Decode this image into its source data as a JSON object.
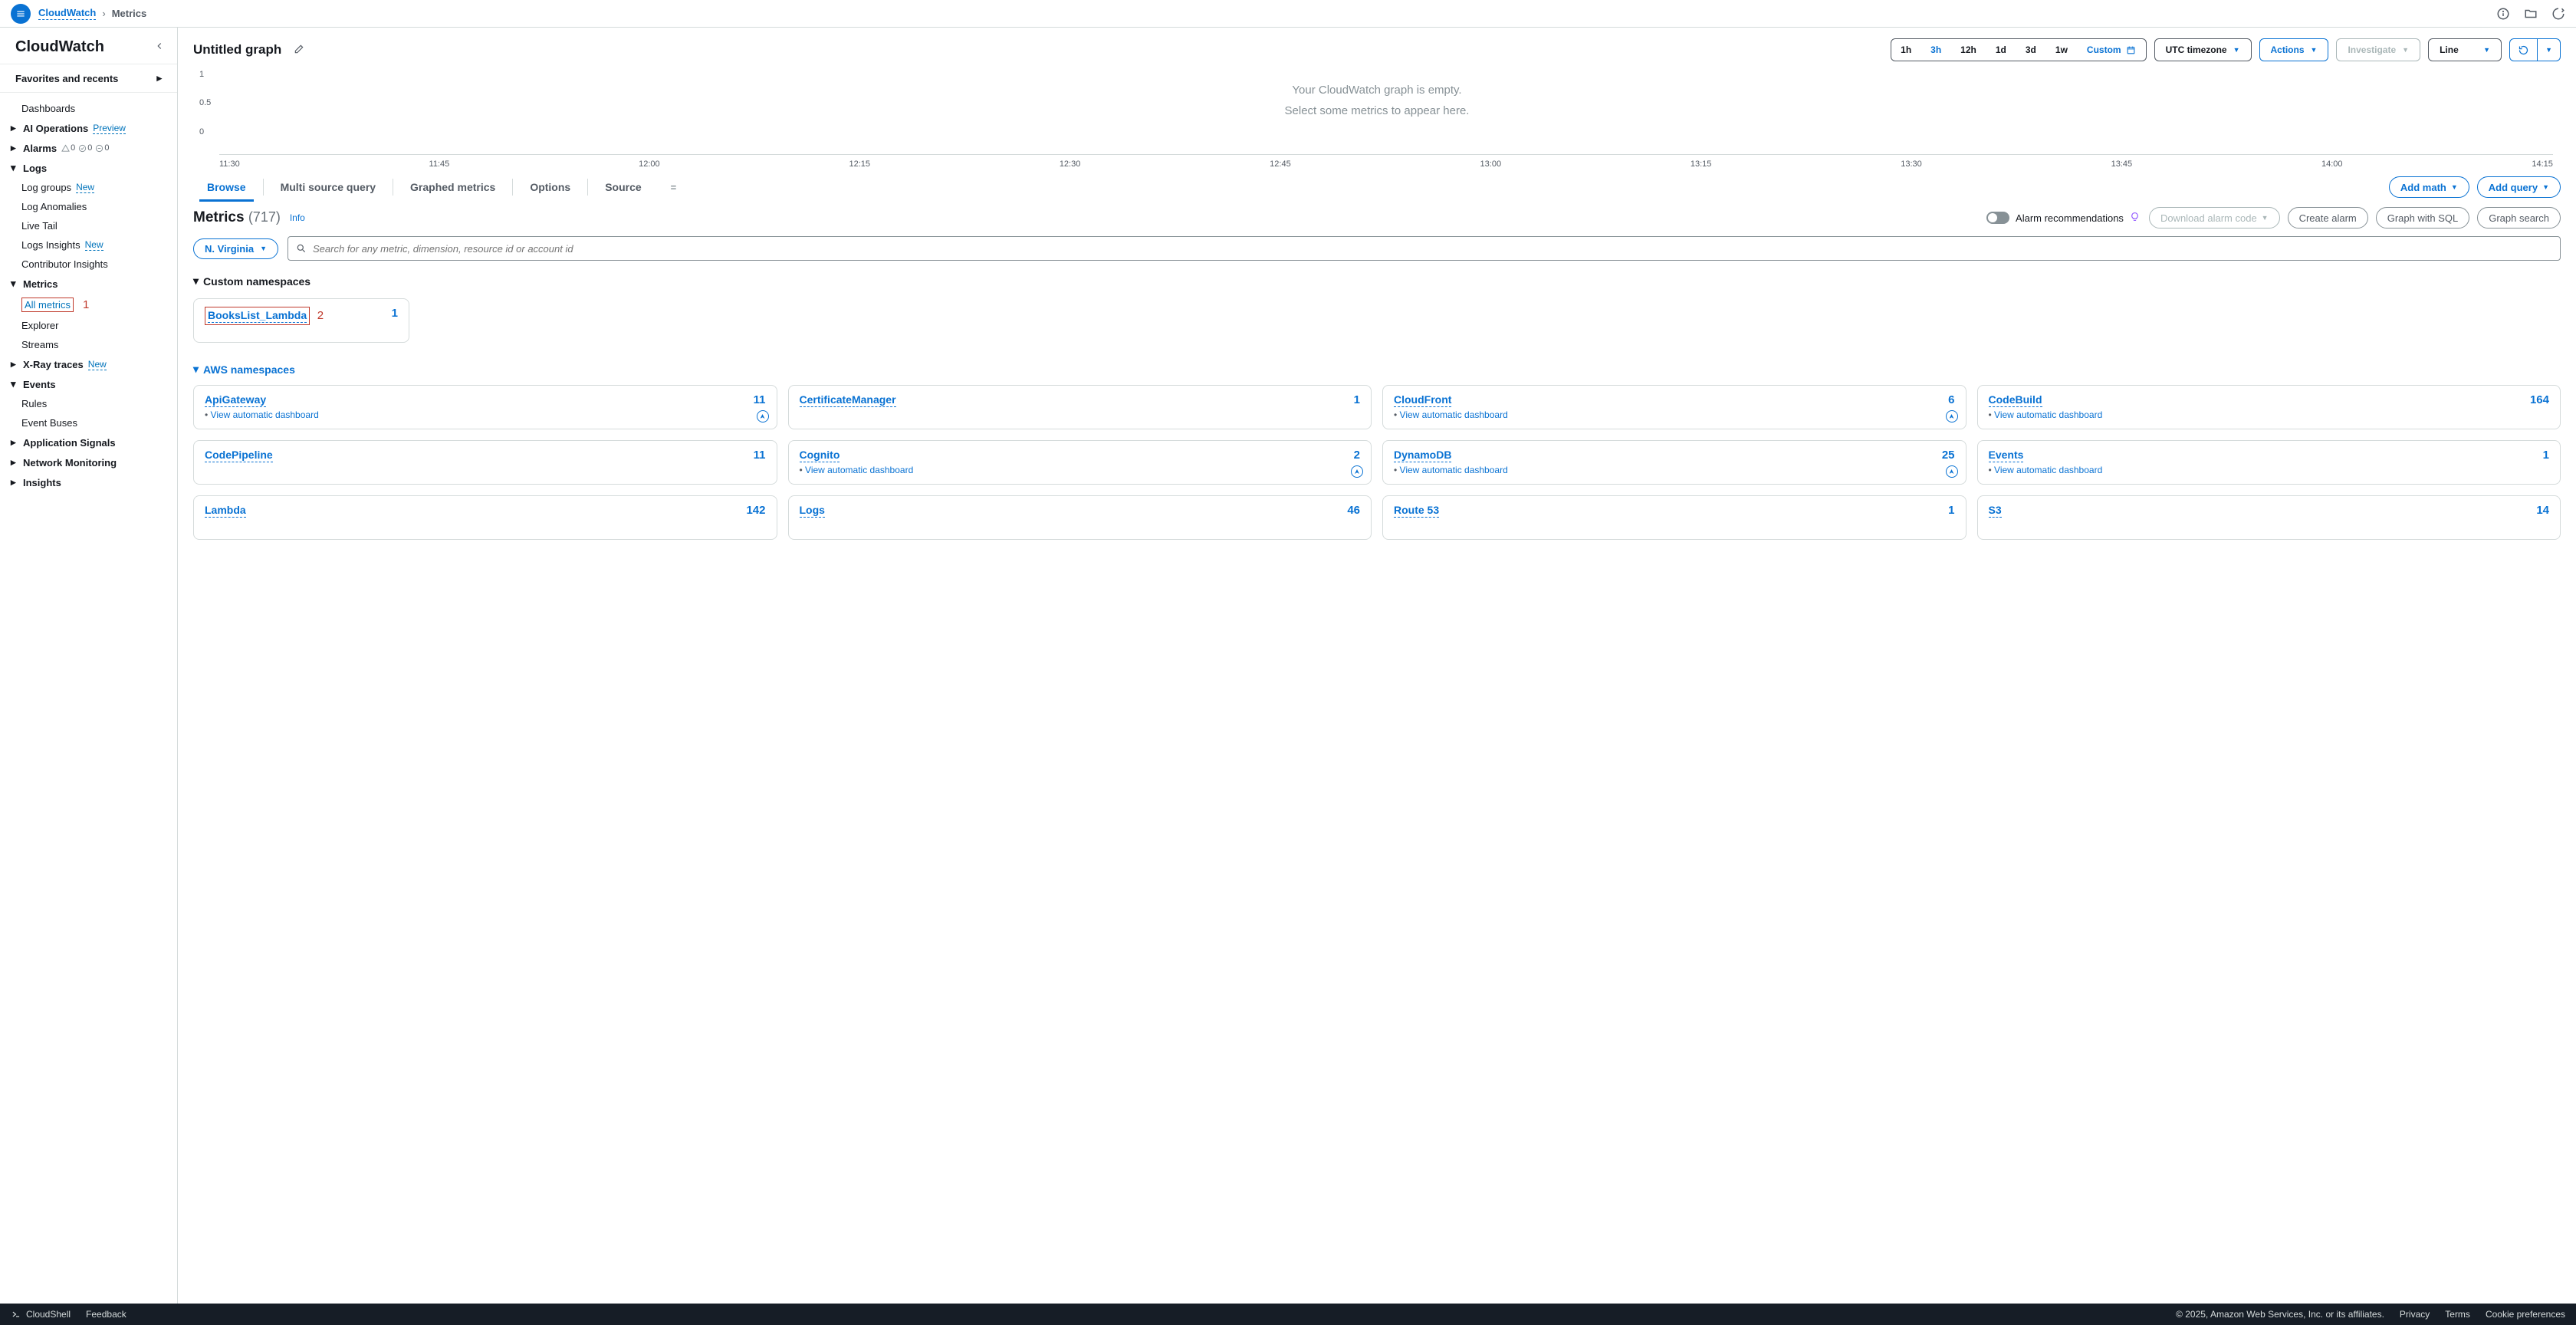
{
  "breadcrumb": {
    "service": "CloudWatch",
    "current": "Metrics"
  },
  "sidebar": {
    "title": "CloudWatch",
    "favorites": "Favorites and recents",
    "dashboards": "Dashboards",
    "ai_ops": "AI Operations",
    "ai_ops_tag": "Preview",
    "alarms": "Alarms",
    "alarm_counts": {
      "a": "0",
      "b": "0",
      "c": "0"
    },
    "logs": "Logs",
    "log_groups": "Log groups",
    "log_anomalies": "Log Anomalies",
    "live_tail": "Live Tail",
    "logs_insights": "Logs Insights",
    "contributor": "Contributor Insights",
    "metrics": "Metrics",
    "all_metrics": "All metrics",
    "explorer": "Explorer",
    "streams": "Streams",
    "xray": "X-Ray traces",
    "events": "Events",
    "rules": "Rules",
    "event_buses": "Event Buses",
    "app_signals": "Application Signals",
    "net_mon": "Network Monitoring",
    "insights": "Insights",
    "new": "New",
    "annot1": "1"
  },
  "toolbar": {
    "title": "Untitled graph",
    "ranges": [
      "1h",
      "3h",
      "12h",
      "1d",
      "3d",
      "1w"
    ],
    "active_range": "3h",
    "custom": "Custom",
    "tz": "UTC timezone",
    "actions": "Actions",
    "investigate": "Investigate",
    "charttype": "Line"
  },
  "chart": {
    "y": [
      "1",
      "0.5",
      "0"
    ],
    "x": [
      "11:30",
      "11:45",
      "12:00",
      "12:15",
      "12:30",
      "12:45",
      "13:00",
      "13:15",
      "13:30",
      "13:45",
      "14:00",
      "14:15"
    ],
    "empty1": "Your CloudWatch graph is empty.",
    "empty2": "Select some metrics to appear here."
  },
  "tabs": {
    "browse": "Browse",
    "multi": "Multi source query",
    "graphed": "Graphed metrics",
    "options": "Options",
    "source": "Source",
    "add_math": "Add math",
    "add_query": "Add query"
  },
  "metrics": {
    "label": "Metrics",
    "count": "(717)",
    "info": "Info",
    "alarm_rec": "Alarm recommendations",
    "download": "Download alarm code",
    "create": "Create alarm",
    "graph_sql": "Graph with SQL",
    "graph_search": "Graph search",
    "region": "N. Virginia",
    "search_placeholder": "Search for any metric, dimension, resource id or account id"
  },
  "custom_ns": {
    "heading": "Custom namespaces",
    "item": {
      "name": "BooksList_Lambda",
      "count": "1",
      "annot": "2"
    }
  },
  "aws_ns": {
    "heading": "AWS namespaces",
    "view_dash": "View automatic dashboard",
    "items": [
      {
        "name": "ApiGateway",
        "count": "11",
        "dash": true,
        "compass": true
      },
      {
        "name": "CertificateManager",
        "count": "1",
        "dash": false,
        "compass": false
      },
      {
        "name": "CloudFront",
        "count": "6",
        "dash": true,
        "compass": true
      },
      {
        "name": "CodeBuild",
        "count": "164",
        "dash": true,
        "compass": false
      },
      {
        "name": "CodePipeline",
        "count": "11",
        "dash": false,
        "compass": false
      },
      {
        "name": "Cognito",
        "count": "2",
        "dash": true,
        "compass": true
      },
      {
        "name": "DynamoDB",
        "count": "25",
        "dash": true,
        "compass": true
      },
      {
        "name": "Events",
        "count": "1",
        "dash": true,
        "compass": false
      },
      {
        "name": "Lambda",
        "count": "142",
        "dash": false,
        "compass": false
      },
      {
        "name": "Logs",
        "count": "46",
        "dash": false,
        "compass": false
      },
      {
        "name": "Route 53",
        "count": "1",
        "dash": false,
        "compass": false
      },
      {
        "name": "S3",
        "count": "14",
        "dash": false,
        "compass": false
      }
    ]
  },
  "footer": {
    "cloudshell": "CloudShell",
    "feedback": "Feedback",
    "copyright": "© 2025, Amazon Web Services, Inc. or its affiliates.",
    "privacy": "Privacy",
    "terms": "Terms",
    "cookie": "Cookie preferences"
  }
}
